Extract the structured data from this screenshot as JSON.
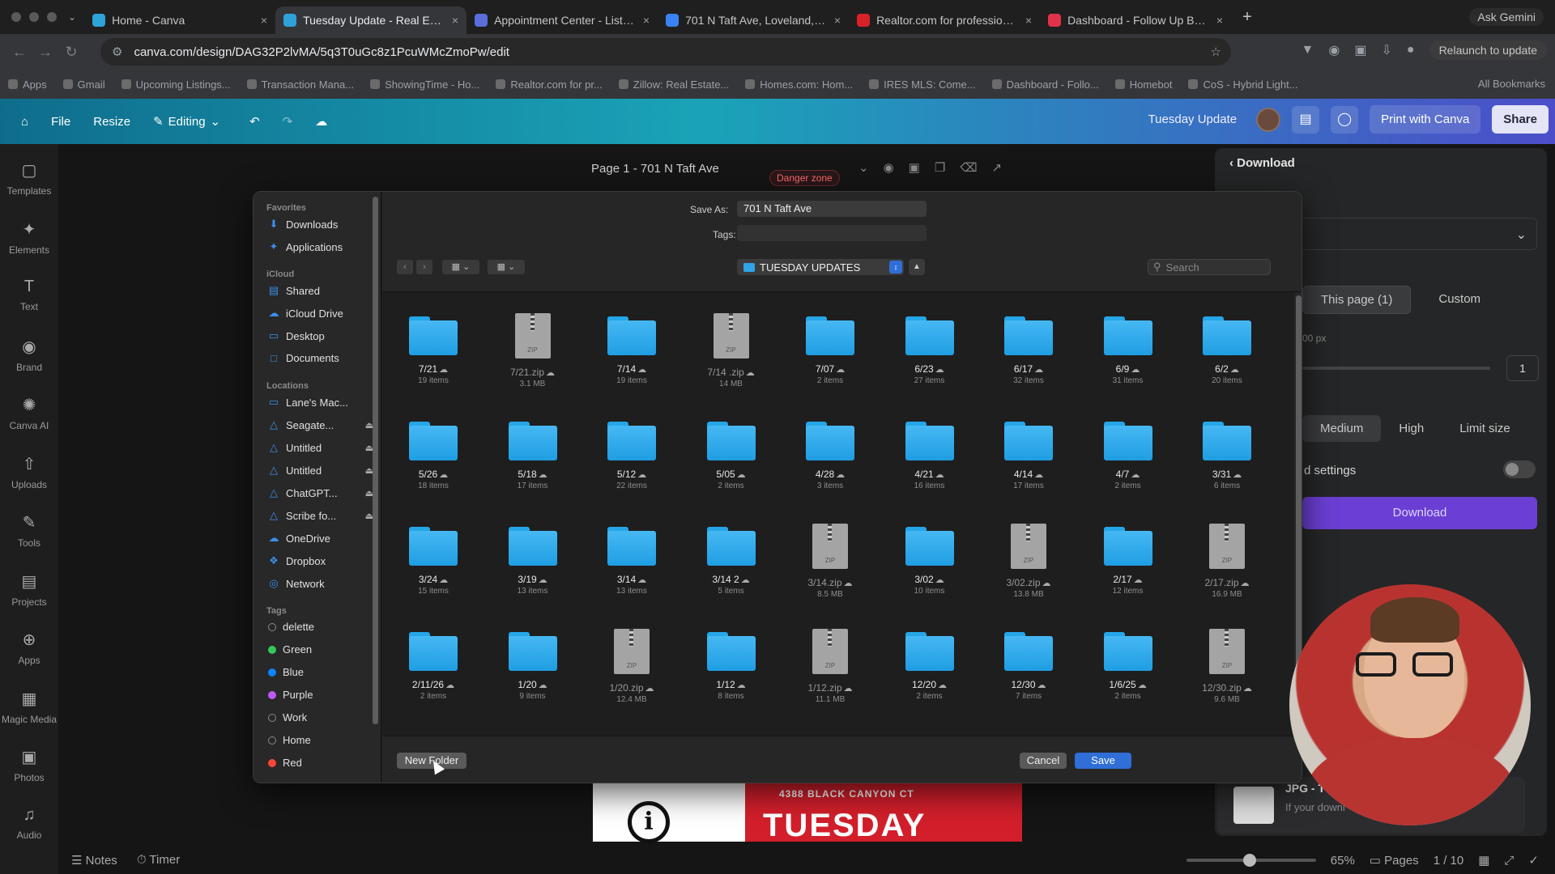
{
  "browser": {
    "tabs": [
      {
        "title": "Home - Canva",
        "color": "#2ea2d9",
        "active": false
      },
      {
        "title": "Tuesday Update - Real Estate",
        "color": "#2ea2d9",
        "active": true
      },
      {
        "title": "Appointment Center - Listing",
        "color": "#5a6ddb",
        "active": false
      },
      {
        "title": "701 N Taft Ave, Loveland, CO",
        "color": "#3b82f6",
        "active": false
      },
      {
        "title": "Realtor.com for professionals",
        "color": "#d92228",
        "active": false
      },
      {
        "title": "Dashboard - Follow Up Boss",
        "color": "#e0334a",
        "active": false
      }
    ],
    "ask_gemini": "Ask Gemini",
    "url": "canva.com/design/DAG32P2lvMA/5q3T0uGc8z1PcuWMcZmoPw/edit",
    "relaunch": "Relaunch to update",
    "bookmarks": [
      "Apps",
      "Gmail",
      "Upcoming Listings...",
      "Transaction Mana...",
      "ShowingTime - Ho...",
      "Realtor.com for pr...",
      "Zillow: Real Estate...",
      "Homes.com: Hom...",
      "IRES MLS: Come...",
      "Dashboard - Follo...",
      "Homebot",
      "CoS - Hybrid Light..."
    ],
    "all_bookmarks": "All Bookmarks"
  },
  "canva": {
    "menu": {
      "file": "File",
      "resize": "Resize",
      "editing": "Editing"
    },
    "design_name": "Tuesday Update",
    "print": "Print with Canva",
    "share": "Share",
    "sidebar": [
      "Templates",
      "Elements",
      "Text",
      "Brand",
      "Canva AI",
      "Uploads",
      "Tools",
      "Projects",
      "Apps",
      "Magic Media",
      "Photos",
      "Audio"
    ],
    "page_title": "Page 1 - 701 N Taft Ave",
    "danger": "Danger zone",
    "design_address": "4388 BLACK CANYON CT",
    "design_big": "TUESDAY",
    "download_panel": {
      "title": "Download",
      "this_page": "This page (1)",
      "custom": "Custom",
      "px_note": "00 px",
      "page_count": "1",
      "quality": [
        "Medium",
        "High",
        "Limit size"
      ],
      "settings": "d settings",
      "button": "Download"
    },
    "toast": {
      "title": "JPG - T",
      "text": "If your downl"
    },
    "bottom": {
      "notes": "Notes",
      "timer": "Timer",
      "zoom": "65%",
      "pages": "Pages",
      "page_of": "1 / 10"
    }
  },
  "dialog": {
    "save_as_label": "Save As:",
    "save_as_value": "701 N Taft Ave",
    "tags_label": "Tags:",
    "location": "TUESDAY UPDATES",
    "search_placeholder": "Search",
    "sidebar": {
      "favorites_label": "Favorites",
      "favorites": [
        "Downloads",
        "Applications"
      ],
      "icloud_label": "iCloud",
      "icloud": [
        "Shared",
        "iCloud Drive",
        "Desktop",
        "Documents"
      ],
      "locations_label": "Locations",
      "locations": [
        "Lane's Mac...",
        "Seagate...",
        "Untitled",
        "Untitled",
        "ChatGPT...",
        "Scribe fo...",
        "OneDrive",
        "Dropbox",
        "Network"
      ],
      "tags_label": "Tags",
      "tags": [
        {
          "name": "delette",
          "color": "#888888",
          "hollow": true
        },
        {
          "name": "Green",
          "color": "#34c759",
          "hollow": false
        },
        {
          "name": "Blue",
          "color": "#0a84ff",
          "hollow": false
        },
        {
          "name": "Purple",
          "color": "#bf5af2",
          "hollow": false
        },
        {
          "name": "Work",
          "color": "#888888",
          "hollow": true
        },
        {
          "name": "Home",
          "color": "#888888",
          "hollow": true
        },
        {
          "name": "Red",
          "color": "#ff453a",
          "hollow": false
        }
      ]
    },
    "items": [
      {
        "name": "7/21",
        "sub": "19 items",
        "type": "folder"
      },
      {
        "name": "7/21.zip",
        "sub": "3.1 MB",
        "type": "zip"
      },
      {
        "name": "7/14",
        "sub": "19 items",
        "type": "folder"
      },
      {
        "name": "7/14 .zip",
        "sub": "14 MB",
        "type": "zip"
      },
      {
        "name": "7/07",
        "sub": "2 items",
        "type": "folder"
      },
      {
        "name": "6/23",
        "sub": "27 items",
        "type": "folder"
      },
      {
        "name": "6/17",
        "sub": "32 items",
        "type": "folder"
      },
      {
        "name": "6/9",
        "sub": "31 items",
        "type": "folder"
      },
      {
        "name": "6/2",
        "sub": "20 items",
        "type": "folder"
      },
      {
        "name": "5/26",
        "sub": "18 items",
        "type": "folder"
      },
      {
        "name": "5/18",
        "sub": "17 items",
        "type": "folder"
      },
      {
        "name": "5/12",
        "sub": "22 items",
        "type": "folder"
      },
      {
        "name": "5/05",
        "sub": "2 items",
        "type": "folder"
      },
      {
        "name": "4/28",
        "sub": "3 items",
        "type": "folder"
      },
      {
        "name": "4/21",
        "sub": "16 items",
        "type": "folder"
      },
      {
        "name": "4/14",
        "sub": "17 items",
        "type": "folder"
      },
      {
        "name": "4/7",
        "sub": "2 items",
        "type": "folder"
      },
      {
        "name": "3/31",
        "sub": "6 items",
        "type": "folder"
      },
      {
        "name": "3/24",
        "sub": "15 items",
        "type": "folder"
      },
      {
        "name": "3/19",
        "sub": "13 items",
        "type": "folder"
      },
      {
        "name": "3/14",
        "sub": "13 items",
        "type": "folder"
      },
      {
        "name": "3/14 2",
        "sub": "5 items",
        "type": "folder"
      },
      {
        "name": "3/14.zip",
        "sub": "8.5 MB",
        "type": "zip"
      },
      {
        "name": "3/02",
        "sub": "10 items",
        "type": "folder"
      },
      {
        "name": "3/02.zip",
        "sub": "13.8 MB",
        "type": "zip"
      },
      {
        "name": "2/17",
        "sub": "12 items",
        "type": "folder"
      },
      {
        "name": "2/17.zip",
        "sub": "16.9 MB",
        "type": "zip"
      },
      {
        "name": "2/11/26",
        "sub": "2 items",
        "type": "folder"
      },
      {
        "name": "1/20",
        "sub": "9 items",
        "type": "folder"
      },
      {
        "name": "1/20.zip",
        "sub": "12.4 MB",
        "type": "zip"
      },
      {
        "name": "1/12",
        "sub": "8 items",
        "type": "folder"
      },
      {
        "name": "1/12.zip",
        "sub": "11.1 MB",
        "type": "zip"
      },
      {
        "name": "12/20",
        "sub": "2 items",
        "type": "folder"
      },
      {
        "name": "12/30",
        "sub": "7 items",
        "type": "folder"
      },
      {
        "name": "1/6/25",
        "sub": "2 items",
        "type": "folder"
      },
      {
        "name": "12/30.zip",
        "sub": "9.6 MB",
        "type": "zip"
      }
    ],
    "new_folder": "New Folder",
    "cancel": "Cancel",
    "save": "Save"
  }
}
